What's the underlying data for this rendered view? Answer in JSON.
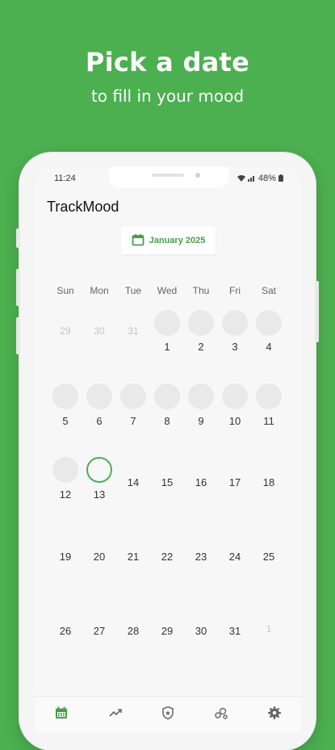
{
  "promo": {
    "title": "Pick a date",
    "subtitle": "to fill in your mood"
  },
  "status_bar": {
    "time": "11:24",
    "battery": "48%"
  },
  "app": {
    "title": "TrackMood",
    "month_label": "January 2025"
  },
  "calendar": {
    "weekdays": [
      "Sun",
      "Mon",
      "Tue",
      "Wed",
      "Thu",
      "Fri",
      "Sat"
    ],
    "weeks": [
      [
        "29",
        "30",
        "31",
        "1",
        "2",
        "3",
        "4"
      ],
      [
        "5",
        "6",
        "7",
        "8",
        "9",
        "10",
        "11"
      ],
      [
        "12",
        "13",
        "14",
        "15",
        "16",
        "17",
        "18"
      ],
      [
        "19",
        "20",
        "21",
        "22",
        "23",
        "24",
        "25"
      ],
      [
        "26",
        "27",
        "28",
        "29",
        "30",
        "31",
        "1"
      ]
    ],
    "today": "13"
  },
  "nav": [
    "calendar-icon",
    "trend-icon",
    "shield-icon",
    "bubbles-icon",
    "gear-icon"
  ],
  "colors": {
    "brand": "#4caf50",
    "accent": "#43a047"
  }
}
